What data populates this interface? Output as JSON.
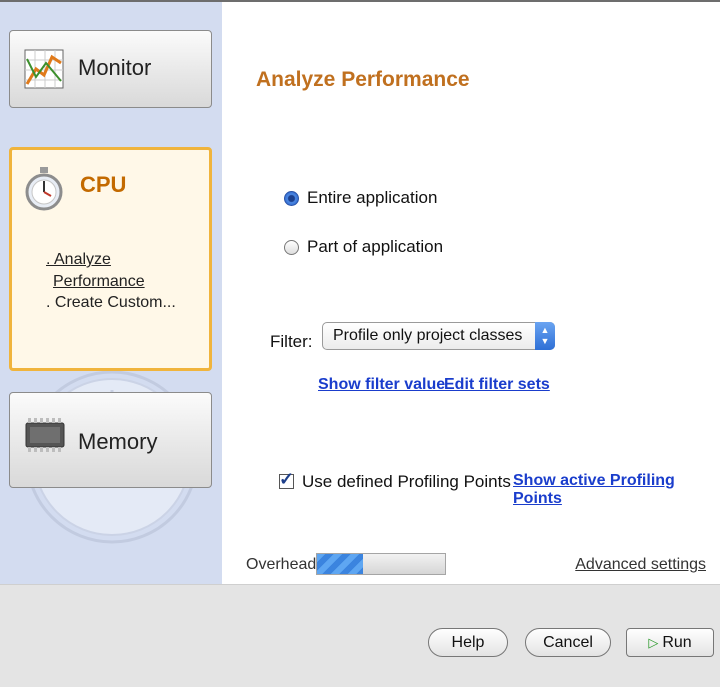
{
  "sidebar": {
    "tasks": [
      {
        "label": "Monitor",
        "icon": "monitor-graph-icon"
      },
      {
        "label": "CPU",
        "icon": "stopwatch-icon",
        "selected": true,
        "sub_items": [
          ". Analyze",
          "Performance",
          ". Create Custom..."
        ]
      },
      {
        "label": "Memory",
        "icon": "memory-chip-icon"
      }
    ]
  },
  "main": {
    "title": "Analyze Performance",
    "scope_options": [
      "Entire application",
      "Part of application"
    ],
    "scope_selected": "Entire application",
    "filter": {
      "label": "Filter:",
      "value": "Profile only project classes",
      "links": [
        "Show filter value",
        "Edit filter sets"
      ]
    },
    "profiling_points": {
      "checked": true,
      "label": "Use defined Profiling Points",
      "link": "Show active Profiling Points"
    },
    "overhead": {
      "label": "Overhead:",
      "level_fraction": 0.36
    },
    "advanced_settings": "Advanced settings"
  },
  "footer": {
    "buttons": [
      "Help",
      "Cancel",
      "Run"
    ]
  },
  "colors": {
    "accent": "#c0701f",
    "selected_border": "#f0b43c",
    "link": "#1a3dcc",
    "sidebar": "#d3dcf0"
  }
}
